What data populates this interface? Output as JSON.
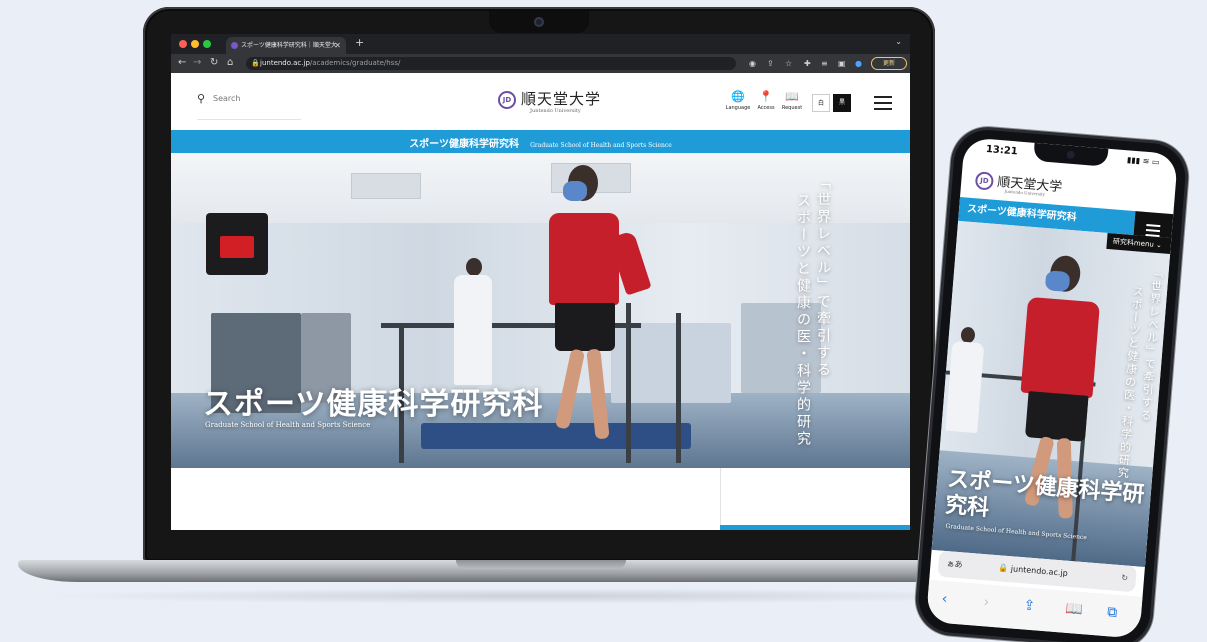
{
  "browser": {
    "tab_title": "スポーツ健康科学研究科｜順天堂大",
    "url_domain": "juntendo.ac.jp",
    "url_path": "/academics/graduate/hss/",
    "update_label": "更新",
    "colors": {
      "close": "#ff5f57",
      "min": "#febc2e",
      "max": "#28c840"
    }
  },
  "site": {
    "search_label": "Search",
    "logo_mark": "JD",
    "logo_text": "順天堂大学",
    "logo_sub": "Juntendo University",
    "nav": [
      {
        "label": "Language",
        "icon": "globe-icon"
      },
      {
        "label": "Access",
        "icon": "map-pin-icon"
      },
      {
        "label": "Request",
        "icon": "book-icon"
      }
    ],
    "contrast_white": "白",
    "contrast_black": "黒",
    "band_jp": "スポーツ健康科学研究科",
    "band_en": "Graduate School of Health and Sports Science",
    "accent": "#1f9bd8"
  },
  "hero": {
    "title": "スポーツ健康科学研究科",
    "subtitle": "Graduate School of Health and Sports Science",
    "vertical_1": "「世界レベル」で牽引する",
    "vertical_2": "スポーツと健康の医・科学的研究"
  },
  "phone": {
    "time": "13:21",
    "status": "▮▮▮ ≋ ▭",
    "logo_text": "順天堂大学",
    "logo_sub": "Juntendo University",
    "band": "スポーツ健康科学研究科",
    "menu": "研究科menu",
    "hero_title": "スポーツ健康科学研究科",
    "hero_sub": "Graduate School of Health and Sports Science",
    "vertical_1": "「世界レベル」で牽引する",
    "vertical_2": "スポーツと健康の医・科学的研究",
    "address_left": "ぁあ",
    "address_url": "juntendo.ac.jp"
  }
}
